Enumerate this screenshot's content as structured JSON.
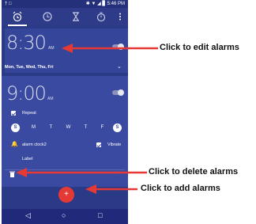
{
  "status_bar": {
    "left": "† □",
    "right": "✱ ▼ ◢ ▊ 5:46 PM"
  },
  "tabs": [
    {
      "name": "alarm-icon"
    },
    {
      "name": "clock-icon"
    },
    {
      "name": "timer-icon"
    },
    {
      "name": "stopwatch-icon"
    },
    {
      "name": "more-icon"
    }
  ],
  "alarm1": {
    "time": "8:30",
    "ampm": "AM",
    "days": "Mon, Tue, Wed, Thu, Fri",
    "enabled": false
  },
  "alarm2": {
    "time": "9:00",
    "ampm": "AM",
    "enabled": false,
    "repeat_label": "Repeat",
    "days": [
      "S",
      "M",
      "T",
      "W",
      "T",
      "F",
      "S"
    ],
    "days_selected": [
      true,
      false,
      false,
      false,
      false,
      false,
      true
    ],
    "ringtone": "alarm clock2",
    "vibrate_label": "Vibrate",
    "label_text": "Label"
  },
  "fab_label": "+",
  "nav": {
    "back": "◁",
    "home": "○",
    "recents": "□"
  },
  "annotations": {
    "edit": "Click to edit alarms",
    "delete": "Click to delete alarms",
    "add": "Click to add alarms"
  },
  "colors": {
    "accent": "#e53935",
    "background": "#2b3a86"
  }
}
